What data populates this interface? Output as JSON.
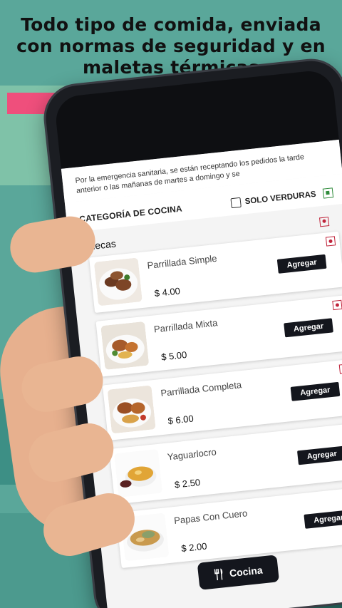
{
  "headline": {
    "line1": "Todo tipo de comida, enviada",
    "line2": "con normas de seguridad y en",
    "line3": "maletas térmicas"
  },
  "notice": {
    "text": "Por la emergencia sanitaria, se están receptando los pedidos la tarde anterior o las mañanas de martes a domingo y se"
  },
  "filter": {
    "category_label": "CATEGORÍA DE COCINA",
    "veg_label": "SOLO VERDURAS",
    "veg_checked": false,
    "veg_icon": "veg-indicator-icon"
  },
  "section": {
    "title": "Huecas",
    "indicator_icon": "non-veg-indicator-icon"
  },
  "items": [
    {
      "name": "Parrillada Simple",
      "price": "$ 4.00",
      "add_label": "Agregar",
      "image": "grilled-meat-plate"
    },
    {
      "name": "Parrillada Mixta",
      "price": "$ 5.00",
      "add_label": "Agregar",
      "image": "mixed-grill-plate"
    },
    {
      "name": "Parrillada Completa",
      "price": "$ 6.00",
      "add_label": "Agregar",
      "image": "full-grill-plate"
    },
    {
      "name": "Yaguarlocro",
      "price": "$ 2.50",
      "add_label": "Agregar",
      "image": "soup-bowl"
    },
    {
      "name": "Papas Con Cuero",
      "price": "$ 2.00",
      "add_label": "Agregar",
      "image": "stew-bowl"
    }
  ],
  "footer": {
    "button_label": "Cocina",
    "button_icon": "utensils-icon"
  },
  "colors": {
    "accent_dark": "#14161d",
    "veg_green": "#2e8b3a",
    "nonveg_red": "#c0233a",
    "background_teal": "#5aa79a"
  }
}
